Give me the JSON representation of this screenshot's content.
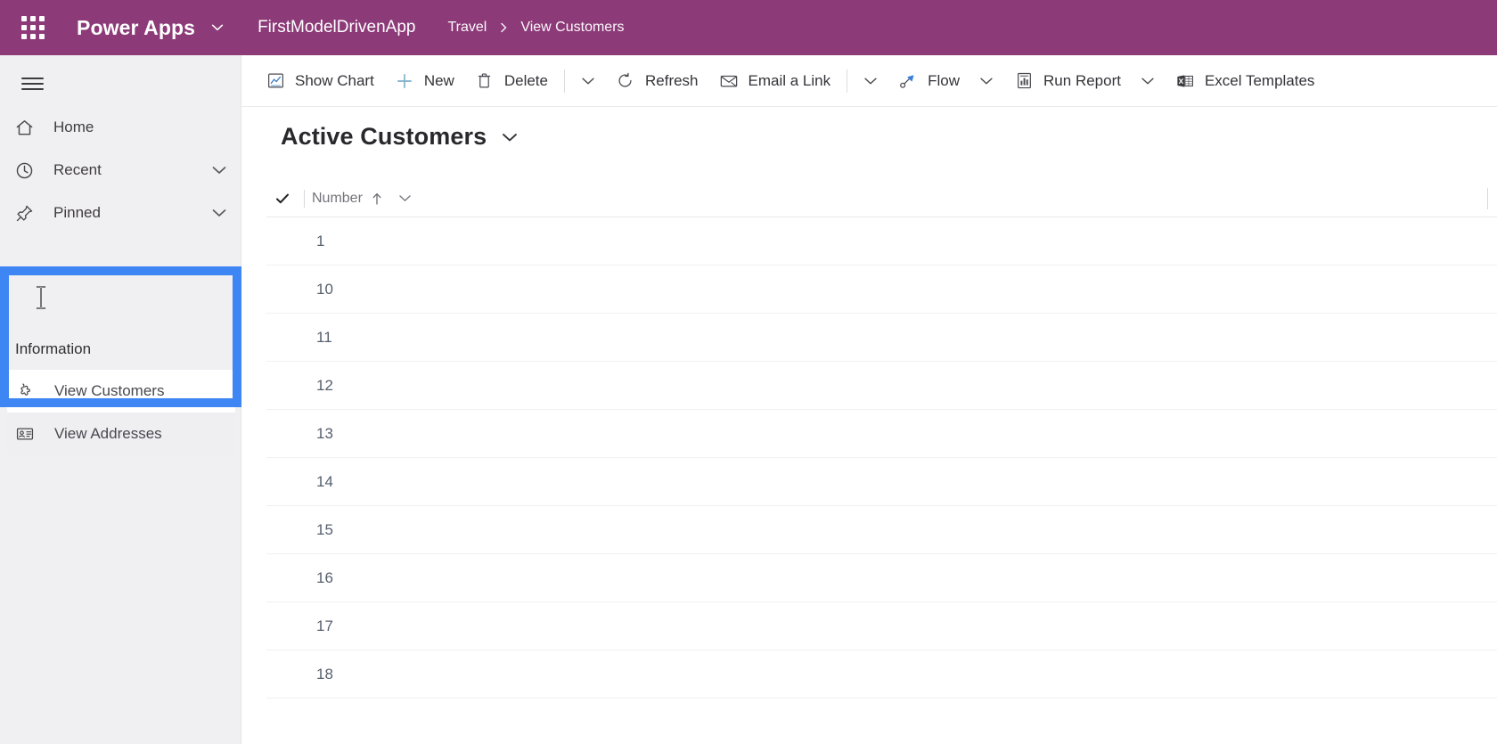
{
  "topbar": {
    "waffle_icon": "app-launcher-waffle-icon",
    "brand": "Power Apps",
    "brand_chevron_icon": "chevron-down-icon",
    "app_name": "FirstModelDrivenApp",
    "breadcrumb": [
      {
        "label": "Travel"
      },
      {
        "label": "View Customers"
      }
    ],
    "breadcrumb_separator_icon": "chevron-right-icon",
    "accent_color": "#8C3A78"
  },
  "sidebar": {
    "hamburger_icon": "hamburger-menu-icon",
    "items": [
      {
        "label": "Home",
        "icon": "home-icon",
        "has_chevron": false
      },
      {
        "label": "Recent",
        "icon": "clock-icon",
        "has_chevron": true
      },
      {
        "label": "Pinned",
        "icon": "pin-icon",
        "has_chevron": true
      }
    ],
    "group": {
      "title": "Information",
      "items": [
        {
          "label": "View Customers",
          "icon": "entity-puzzle-icon",
          "selected": true
        },
        {
          "label": "View Addresses",
          "icon": "id-card-icon",
          "selected": false
        }
      ]
    },
    "highlight_color": "#3D86F4",
    "background_color": "#F0EFF1"
  },
  "commandbar": {
    "items": [
      {
        "label": "Show Chart",
        "icon": "chart-icon",
        "type": "button"
      },
      {
        "label": "New",
        "icon": "plus-icon",
        "type": "button"
      },
      {
        "label": "Delete",
        "icon": "trash-icon",
        "type": "button"
      },
      {
        "label": "",
        "icon": "chevron-down-icon",
        "type": "caret"
      },
      {
        "label": "Refresh",
        "icon": "refresh-icon",
        "type": "button"
      },
      {
        "label": "Email a Link",
        "icon": "email-link-icon",
        "type": "button"
      },
      {
        "label": "",
        "icon": "chevron-down-icon",
        "type": "caret"
      },
      {
        "label": "Flow",
        "icon": "flow-icon",
        "type": "button"
      },
      {
        "label": "",
        "icon": "chevron-down-icon",
        "type": "caret"
      },
      {
        "label": "Run Report",
        "icon": "report-icon",
        "type": "button"
      },
      {
        "label": "",
        "icon": "chevron-down-icon",
        "type": "caret"
      },
      {
        "label": "Excel Templates",
        "icon": "excel-icon",
        "type": "button"
      }
    ]
  },
  "view": {
    "title": "Active Customers",
    "title_chevron_icon": "chevron-down-icon",
    "select_all_icon": "checkmark-icon",
    "columns": [
      {
        "label": "Number",
        "sort": "ascending",
        "sort_icon": "arrow-up-icon",
        "menu_icon": "chevron-down-icon"
      }
    ],
    "rows": [
      {
        "number": "1"
      },
      {
        "number": "10"
      },
      {
        "number": "11"
      },
      {
        "number": "12"
      },
      {
        "number": "13"
      },
      {
        "number": "14"
      },
      {
        "number": "15"
      },
      {
        "number": "16"
      },
      {
        "number": "17"
      },
      {
        "number": "18"
      }
    ]
  }
}
